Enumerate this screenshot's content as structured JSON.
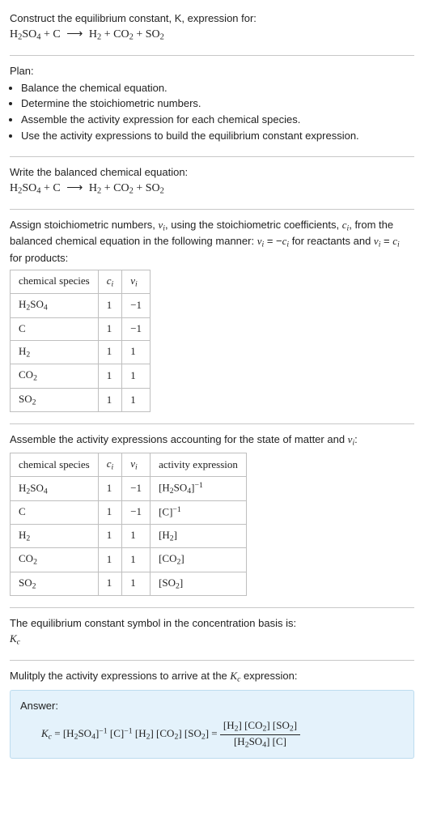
{
  "intro": {
    "line1": "Construct the equilibrium constant, K, expression for:"
  },
  "equation_main": "H₂SO₄ + C ⟶ H₂ + CO₂ + SO₂",
  "plan": {
    "title": "Plan:",
    "items": [
      "Balance the chemical equation.",
      "Determine the stoichiometric numbers.",
      "Assemble the activity expression for each chemical species.",
      "Use the activity expressions to build the equilibrium constant expression."
    ]
  },
  "balanced": {
    "text": "Write the balanced chemical equation:",
    "equation": "H₂SO₄ + C ⟶ H₂ + CO₂ + SO₂"
  },
  "stoich": {
    "text": "Assign stoichiometric numbers, νᵢ, using the stoichiometric coefficients, cᵢ, from the balanced chemical equation in the following manner: νᵢ = −cᵢ for reactants and νᵢ = cᵢ for products:",
    "headers": [
      "chemical species",
      "cᵢ",
      "νᵢ"
    ],
    "rows": [
      {
        "sp": "H₂SO₄",
        "c": "1",
        "v": "−1"
      },
      {
        "sp": "C",
        "c": "1",
        "v": "−1"
      },
      {
        "sp": "H₂",
        "c": "1",
        "v": "1"
      },
      {
        "sp": "CO₂",
        "c": "1",
        "v": "1"
      },
      {
        "sp": "SO₂",
        "c": "1",
        "v": "1"
      }
    ]
  },
  "activity": {
    "text": "Assemble the activity expressions accounting for the state of matter and νᵢ:",
    "headers": [
      "chemical species",
      "cᵢ",
      "νᵢ",
      "activity expression"
    ],
    "rows": [
      {
        "sp": "H₂SO₄",
        "c": "1",
        "v": "−1",
        "act_html": "[H<sub>2</sub>SO<sub>4</sub>]<sup>−1</sup>"
      },
      {
        "sp": "C",
        "c": "1",
        "v": "−1",
        "act_html": "[C]<sup>−1</sup>"
      },
      {
        "sp": "H₂",
        "c": "1",
        "v": "1",
        "act_html": "[H<sub>2</sub>]"
      },
      {
        "sp": "CO₂",
        "c": "1",
        "v": "1",
        "act_html": "[CO<sub>2</sub>]"
      },
      {
        "sp": "SO₂",
        "c": "1",
        "v": "1",
        "act_html": "[SO<sub>2</sub>]"
      }
    ]
  },
  "kc_symbol": {
    "text": "The equilibrium constant symbol in the concentration basis is:",
    "symbol": "K꜀"
  },
  "multiply": {
    "text": "Mulitply the activity expressions to arrive at the K꜀ expression:"
  },
  "answer": {
    "label": "Answer:",
    "lhs_html": "<span class=\"ital\">K<sub>c</sub></span> = [H<sub>2</sub>SO<sub>4</sub>]<sup>−1</sup> [C]<sup>−1</sup> [H<sub>2</sub>] [CO<sub>2</sub>] [SO<sub>2</sub>] = ",
    "num_html": "[H<sub>2</sub>] [CO<sub>2</sub>] [SO<sub>2</sub>]",
    "den_html": "[H<sub>2</sub>SO<sub>4</sub>] [C]"
  },
  "chart_data": {
    "type": "table",
    "tables": [
      {
        "title": "Stoichiometric numbers",
        "columns": [
          "chemical species",
          "c_i",
          "nu_i"
        ],
        "rows": [
          [
            "H2SO4",
            1,
            -1
          ],
          [
            "C",
            1,
            -1
          ],
          [
            "H2",
            1,
            1
          ],
          [
            "CO2",
            1,
            1
          ],
          [
            "SO2",
            1,
            1
          ]
        ]
      },
      {
        "title": "Activity expressions",
        "columns": [
          "chemical species",
          "c_i",
          "nu_i",
          "activity expression"
        ],
        "rows": [
          [
            "H2SO4",
            1,
            -1,
            "[H2SO4]^-1"
          ],
          [
            "C",
            1,
            -1,
            "[C]^-1"
          ],
          [
            "H2",
            1,
            1,
            "[H2]"
          ],
          [
            "CO2",
            1,
            1,
            "[CO2]"
          ],
          [
            "SO2",
            1,
            1,
            "[SO2]"
          ]
        ]
      }
    ]
  }
}
